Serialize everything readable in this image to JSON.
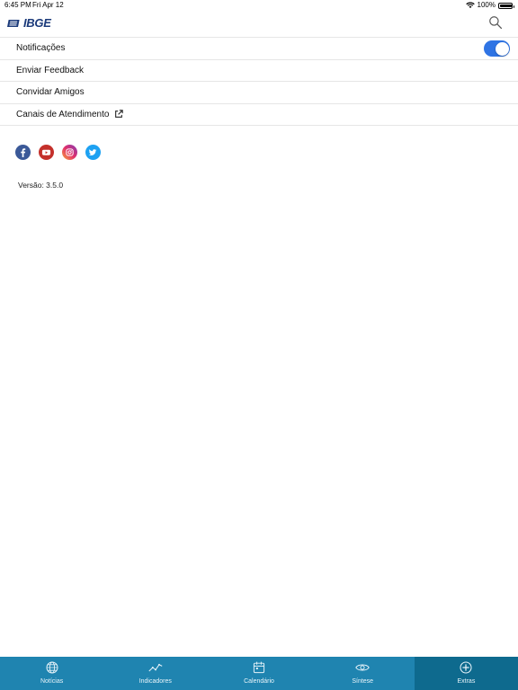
{
  "status_bar": {
    "time": "6:45 PM",
    "date": "Fri Apr 12",
    "battery": "100%",
    "battery_level": 1.0
  },
  "header": {
    "logo_text": "IBGE",
    "icons": [
      "ibge-logo-mark",
      "search-icon"
    ]
  },
  "menu": {
    "items": [
      {
        "label": "Notificações",
        "control": "toggle",
        "toggle_on": true
      },
      {
        "label": "Enviar Feedback"
      },
      {
        "label": "Convidar Amigos"
      },
      {
        "label": "Canais de Atendimento",
        "icon": "external-link-icon"
      }
    ]
  },
  "socials": [
    {
      "name": "facebook-icon",
      "color": "#3b5998"
    },
    {
      "name": "youtube-icon",
      "color": "#c4302b"
    },
    {
      "name": "instagram-icon",
      "color": "#c13584"
    },
    {
      "name": "twitter-icon",
      "color": "#1da1f2"
    }
  ],
  "version_text": "Versão: 3.5.0",
  "tabbar": {
    "tabs": [
      {
        "label": "Notícias",
        "icon": "globe-icon",
        "active": false
      },
      {
        "label": "Indicadores",
        "icon": "trend-line-icon",
        "active": false
      },
      {
        "label": "Calendário",
        "icon": "calendar-icon",
        "active": false
      },
      {
        "label": "Síntese",
        "icon": "eye-icon",
        "active": false
      },
      {
        "label": "Extras",
        "icon": "plus-circle-icon",
        "active": true
      }
    ]
  },
  "colors": {
    "tabbar_bg": "#1f84b0",
    "tabbar_active_bg": "#0e6a8e",
    "toggle_on": "#2f74e4",
    "logo": "#1b3a7a",
    "divider": "#e6e6e6"
  }
}
